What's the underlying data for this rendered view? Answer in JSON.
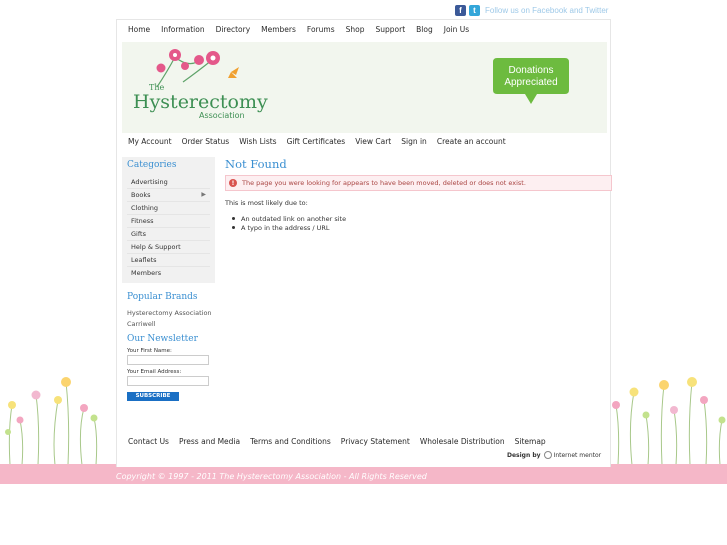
{
  "social": {
    "facebook_icon": "facebook-icon",
    "twitter_icon": "twitter-icon",
    "follow_text": "Follow us on Facebook and Twitter"
  },
  "top_nav": [
    "Home",
    "Information",
    "Directory",
    "Members",
    "Forums",
    "Shop",
    "Support",
    "Blog",
    "Join Us"
  ],
  "banner": {
    "logo_the": "The",
    "logo_main": "Hysterectomy",
    "logo_sub": "Association",
    "donate_line1": "Donations",
    "donate_line2": "Appreciated"
  },
  "account_nav": [
    "My Account",
    "Order Status",
    "Wish Lists",
    "Gift Certificates",
    "View Cart",
    "Sign in",
    "Create an account"
  ],
  "sidebar": {
    "categories_title": "Categories",
    "categories": [
      "Advertising",
      "Books",
      "Clothing",
      "Fitness",
      "Gifts",
      "Help & Support",
      "Leaflets",
      "Members"
    ],
    "brands_title": "Popular Brands",
    "brands": [
      "Hysterectomy Association",
      "Carriwell"
    ],
    "newsletter_title": "Our Newsletter",
    "first_name_label": "Your First Name:",
    "email_label": "Your Email Address:",
    "subscribe_label": "SUBSCRIBE"
  },
  "main": {
    "title": "Not Found",
    "error": "The page you were looking for appears to have been moved, deleted or does not exist.",
    "likely": "This is most likely due to:",
    "reasons": [
      "An outdated link on another site",
      "A typo in the address / URL"
    ]
  },
  "footer_nav": [
    "Contact Us",
    "Press and Media",
    "Terms and Conditions",
    "Privacy Statement",
    "Wholesale Distribution",
    "Sitemap"
  ],
  "design": {
    "by": "Design by",
    "company": "Internet mentor"
  },
  "copyright": "Copyright © 1997 - 2011 The Hysterectomy Association - All Rights Reserved",
  "colors": {
    "accent_blue": "#3a8fd1",
    "donate_green": "#6dbb3f",
    "pink_band": "#f5b7c8",
    "logo_green": "#3d8f53"
  }
}
